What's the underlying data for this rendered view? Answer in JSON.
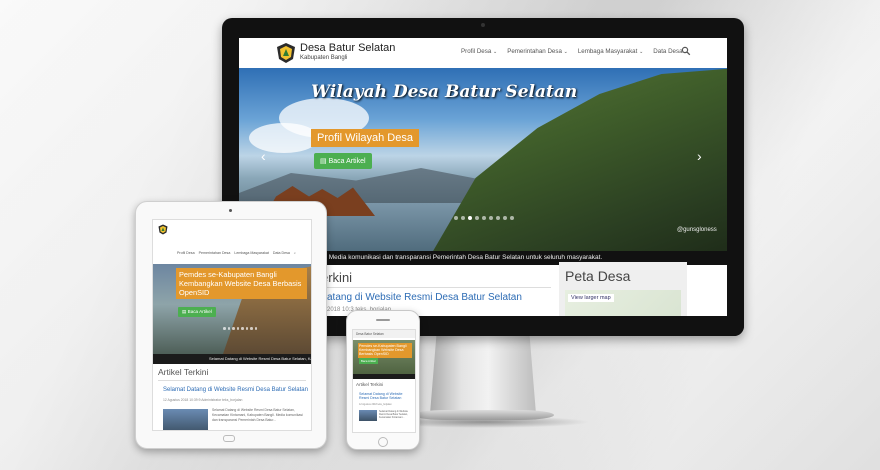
{
  "desktop": {
    "site_title": "Desa Batur Selatan",
    "site_subtitle": "Kabupaten Bangli",
    "nav": [
      {
        "label": "Profil Desa"
      },
      {
        "label": "Pemerintahan Desa"
      },
      {
        "label": "Lembaga Masyarakat"
      },
      {
        "label": "Data Desa"
      }
    ],
    "hero_title": "Wilayah Desa Batur Selatan",
    "hero_caption": "Profil Wilayah Desa",
    "hero_button": "Baca Artikel",
    "photo_credit": "@gunsgloness",
    "ticker": "ngli. Media komunikasi dan transparansi Pemerintah Desa Batur Selatan untuk seluruh masyarakat.",
    "section_heading": "erkini",
    "article_link": "atang di Website Resmi Desa Batur Selatan",
    "article_meta": "2018 10:3    teks_borjalan",
    "sidebar_heading": "Peta Desa",
    "map_button": "View larger map"
  },
  "tablet": {
    "nav": [
      {
        "label": "Profil Desa"
      },
      {
        "label": "Pemerintahan Desa"
      },
      {
        "label": "Lembaga Masyarakat"
      },
      {
        "label": "Data Desa"
      }
    ],
    "hero_caption": "Pemdes se-Kabupaten Bangli Kembangkan Website Desa Berbasis OpenSID",
    "hero_button": "Baca Artikel",
    "ticker": "Selamat Datang di Website Resmi Desa Batur Selatan, Ka",
    "section_heading": "Artikel Terkini",
    "article_link": "Selamat Datang di Website Resmi Desa Batur Selatan",
    "article_meta": "12 Agustus 2018 10:39:9    Administrator    teks_borjalan",
    "article_body": "Selamat Datang di Website Resmi Desa Batur Selatan, Kecamatan Kintamani, Kabupaten Bangli. Media komunikasi dan transparansi Pemerintah Desa Batur..."
  },
  "phone": {
    "top_label": "Desa Batur Selatan",
    "hero_caption": "Pemdes se-Kabupaten Bangli Kembangkan Website Desa Berbasis OpenSID",
    "hero_button": "Baca Artikel",
    "section_heading": "Artikel Terkini",
    "article_link": "Selamat Datang di Website Resmi Desa Batur Selatan",
    "article_meta": "12 Agustus 2018    teks_borjalan",
    "article_body": "Selamat Datang di Website Resmi Desa Batur Selatan, Kecamatan Kintamani..."
  },
  "colors": {
    "accent_orange": "#e3982c",
    "button_green": "#4caf50",
    "link_blue": "#2d6cb5"
  }
}
